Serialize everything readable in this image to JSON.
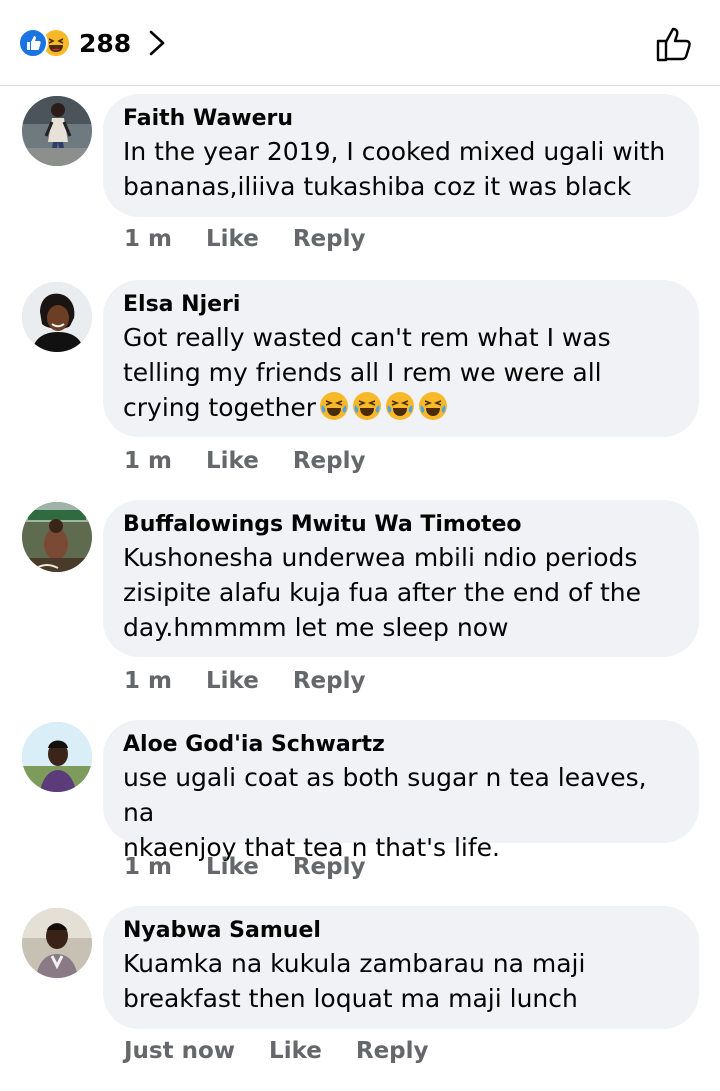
{
  "header": {
    "reaction_count": "288",
    "reactions": [
      "like-icon",
      "haha-icon"
    ]
  },
  "comments": [
    {
      "author": "Faith Waweru",
      "text": "In the year 2019, I cooked mixed ugali with\nbananas,iliiva tukashiba coz it was black",
      "time": "1 m",
      "like": "Like",
      "reply": "Reply"
    },
    {
      "author": "Elsa Njeri",
      "text": "Got really wasted can't rem what I was\ntelling my friends all I rem we were all\ncrying together",
      "emojis": [
        "crying-laughing-emoji",
        "crying-laughing-emoji",
        "crying-laughing-emoji",
        "crying-laughing-emoji"
      ],
      "time": "1 m",
      "like": "Like",
      "reply": "Reply"
    },
    {
      "author": "Buffalowings Mwitu Wa Timoteo",
      "text": "Kushonesha underwea mbili ndio periods\nzisipite alafu kuja fua after the end of the\nday.hmmmm let me sleep now",
      "time": "1 m",
      "like": "Like",
      "reply": "Reply"
    },
    {
      "author": "Aloe God'ia Schwartz",
      "text": "use ugali coat as both sugar n tea leaves, na\nnkaenjoy that tea n that's life.",
      "time": "1 m",
      "like": "Like",
      "reply": "Reply"
    },
    {
      "author": "Nyabwa Samuel",
      "text": "Kuamka na kukula zambarau na maji\nbreakfast then loquat ma maji lunch",
      "time": "Just now",
      "like": "Like",
      "reply": "Reply"
    }
  ],
  "colors": {
    "like_blue": "#1b74e4",
    "haha_yellow": "#f7b928",
    "bubble_bg": "#f0f2f5",
    "meta_gray": "#65676b"
  }
}
